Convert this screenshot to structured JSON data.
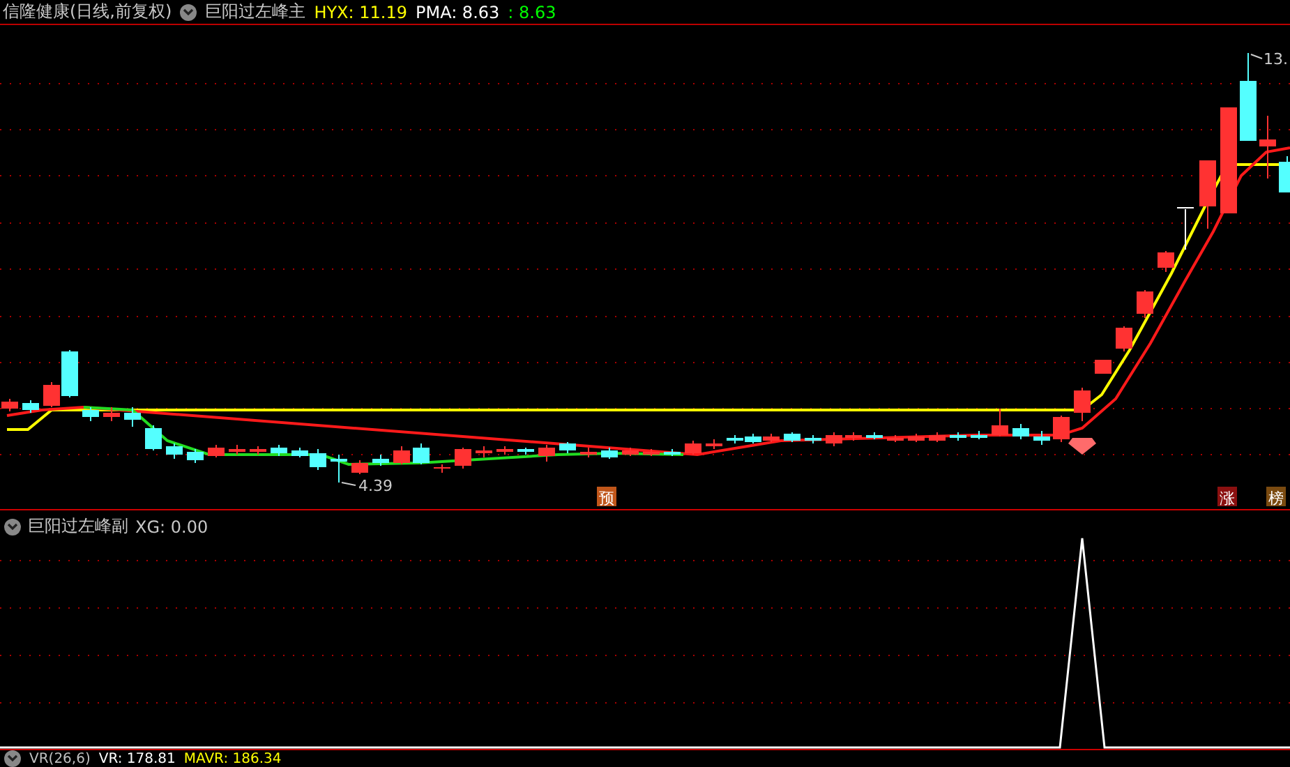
{
  "main_pane": {
    "title": "信隆健康(日线,前复权)",
    "indicator": "巨阳过左峰主",
    "readings": [
      {
        "text": "HYX: 11.19",
        "color": "#ffff00"
      },
      {
        "text": "PMA: 8.63",
        "color": "#ffffff"
      },
      {
        "text": ": 8.63",
        "color": "#00ff00"
      }
    ],
    "price_labels": [
      "4.39",
      "13."
    ],
    "signal_tags": [
      {
        "text": "预",
        "color": "#c0561a"
      },
      {
        "text": "涨",
        "color": "#8b1010"
      },
      {
        "text": "榜",
        "color": "#7a4a10"
      }
    ]
  },
  "sub_pane": {
    "indicator": "巨阳过左峰副",
    "reading": "XG: 0.00"
  },
  "bottom_pane": {
    "readings": [
      {
        "text": "VR(26,6)",
        "color": "#c0c0c0"
      },
      {
        "text": "VR: 178.81",
        "color": "#ffffff"
      },
      {
        "text": "MAVR: 186.34",
        "color": "#ffff00"
      }
    ]
  }
}
